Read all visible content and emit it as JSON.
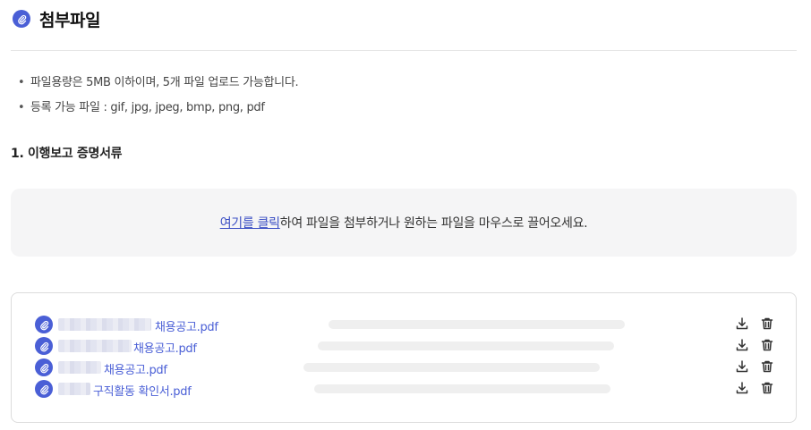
{
  "header": {
    "title": "첨부파일",
    "icon": "paperclip-icon"
  },
  "notes": [
    "파일용량은 5MB 이하이며, 5개 파일 업로드 가능합니다.",
    "등록 가능 파일 : gif, jpg, jpeg, bmp, png, pdf"
  ],
  "section": {
    "title": "1. 이행보고 증명서류"
  },
  "dropzone": {
    "link_text": "여기를 클릭",
    "rest_text": "하여 파일을 첨부하거나 원하는 파일을 마우스로 끌어오세요."
  },
  "files": [
    {
      "name": "채용공고.pdf"
    },
    {
      "name": "채용공고.pdf"
    },
    {
      "name": "채용공고.pdf"
    },
    {
      "name": "구직활동 확인서.pdf"
    }
  ],
  "colors": {
    "accent": "#4a5fd6",
    "link": "#3b4fc4",
    "dropzone_bg": "#f5f5f6"
  }
}
